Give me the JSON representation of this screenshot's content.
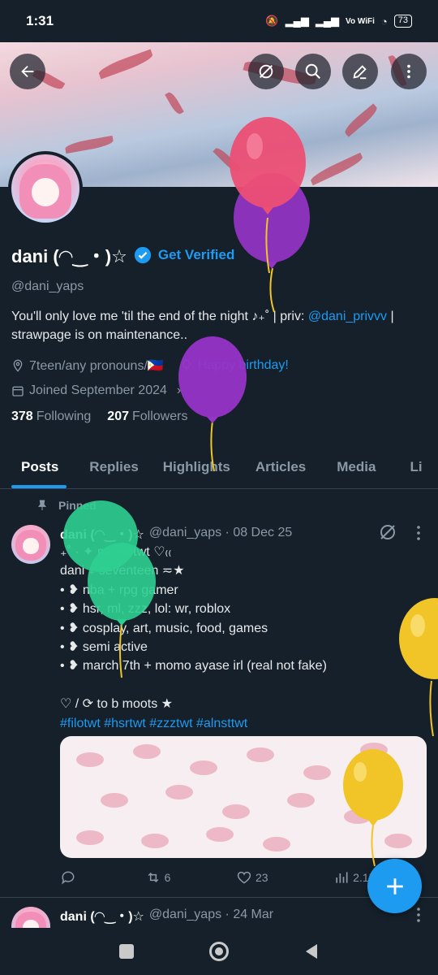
{
  "status_bar": {
    "time": "1:31",
    "network": "Vo WiFi",
    "battery": "73"
  },
  "profile": {
    "display_name": "dani (◠‿・)☆",
    "get_verified": "Get Verified",
    "handle": "@dani_yaps",
    "bio_text": "You'll only love me 'til the end of the night ♪₊˚ | priv: ",
    "bio_link": "@dani_privvv",
    "bio_text2": " | strawpage is on maintenance..",
    "pronouns": "7teen/any pronouns/🇵🇭",
    "birthday": "Happy birthday!",
    "joined": "Joined September 2024",
    "following_count": "378",
    "following_label": "Following",
    "followers_count": "207",
    "followers_label": "Followers"
  },
  "tabs": [
    "Posts",
    "Replies",
    "Highlights",
    "Articles",
    "Media",
    "Li"
  ],
  "pinned_label": "Pinned",
  "posts": [
    {
      "name": "dani (◠‿・)☆",
      "meta": "@dani_yaps · 08 Dec 25",
      "lines": [
        "₊˚ · ✦ momotwt ♡₍₍",
        "dani ₊ seventeen ≂★",
        "• ❥ nba + rpg gamer",
        "• ❥ hsr, ml, zzz, lol: wr, roblox",
        "• ❥ cosplay, art, music, food, games",
        "• ❥ semi active",
        "• ❥ march 7th + momo ayase irl (real not fake)",
        "",
        "♡ / ⟳ to b moots ★"
      ],
      "hashtags": "#filotwt #hsrtwt #zzztwt #alnsttwt",
      "actions": {
        "replies": "",
        "reposts": "6",
        "likes": "23",
        "views": "2.1K"
      }
    },
    {
      "name": "dani (◠‿・)☆",
      "meta": "@dani_yaps · 24 Mar"
    }
  ],
  "colors": {
    "background": "#15202b",
    "accent": "#1d9bf0",
    "secondary_text": "#8b98a5",
    "balloon_pink": "#ec4f74",
    "balloon_purple": "#9634c8",
    "balloon_green": "#2ecf91",
    "balloon_yellow": "#f1c528"
  },
  "icons": [
    "back-arrow-icon",
    "grok-icon",
    "search-icon",
    "edit-icon",
    "more-icon",
    "verified-icon",
    "location-icon",
    "balloon-icon",
    "calendar-icon",
    "pin-icon",
    "reply-icon",
    "repost-icon",
    "like-icon",
    "views-icon",
    "plus-icon"
  ]
}
